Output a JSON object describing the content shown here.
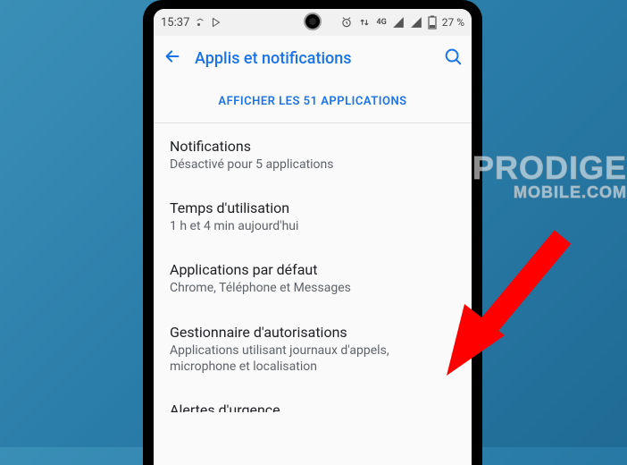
{
  "statusbar": {
    "time": "15:37",
    "network_label": "4G",
    "battery_label": "27 %"
  },
  "appbar": {
    "title": "Applis et notifications"
  },
  "show_all_label": "AFFICHER LES 51 APPLICATIONS",
  "items": [
    {
      "title": "Notifications",
      "sub": "Désactivé pour 5 applications"
    },
    {
      "title": "Temps d'utilisation",
      "sub": "1 h et 4 min aujourd'hui"
    },
    {
      "title": "Applications par défaut",
      "sub": "Chrome, Téléphone et Messages"
    },
    {
      "title": "Gestionnaire d'autorisations",
      "sub": "Applications utilisant journaux d'appels, microphone et localisation"
    },
    {
      "title": "Alertes d'urgence",
      "sub": ""
    }
  ],
  "watermark": {
    "line1": "PRODIGE",
    "line2": "MOBILE.COM"
  }
}
